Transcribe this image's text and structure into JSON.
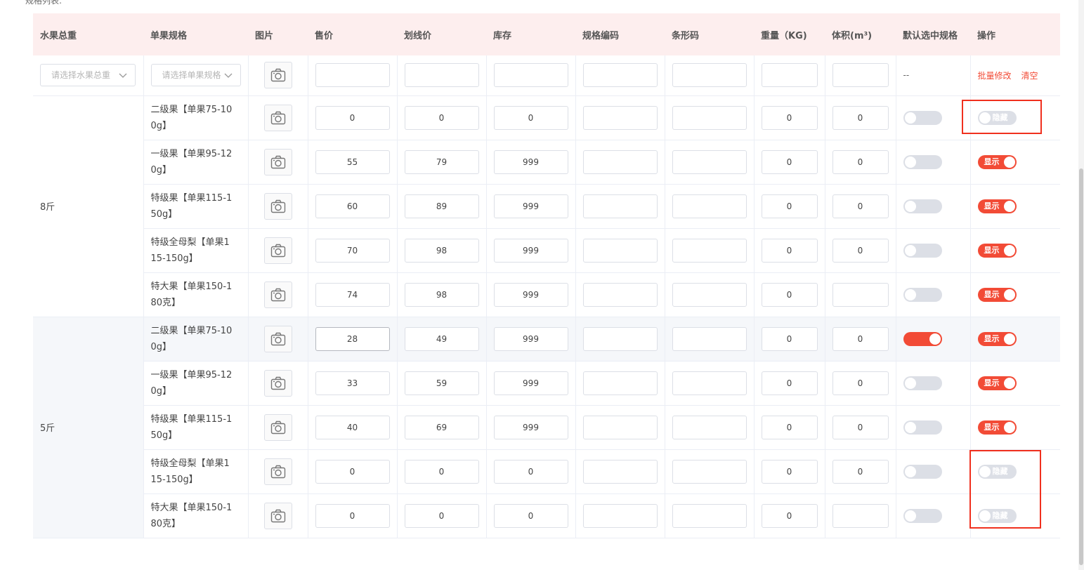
{
  "section_label": "规格列表:",
  "headers": [
    "水果总重",
    "单果规格",
    "图片",
    "售价",
    "划线价",
    "库存",
    "规格编码",
    "条形码",
    "重量（KG)",
    "体积(m³)",
    "默认选中规格",
    "操作"
  ],
  "filter_row": {
    "weight_placeholder": "请选择水果总重",
    "spec_placeholder": "请选择单果规格",
    "default_text": "--",
    "batch_edit": "批量修改",
    "clear": "清空"
  },
  "toggle_labels": {
    "shown": "显示",
    "hidden": "隐藏"
  },
  "groups": [
    {
      "weight": "8斤",
      "rows": [
        {
          "spec": "二级果【单果75-100g】",
          "price": "0",
          "strike": "0",
          "stock": "0",
          "weight": "0",
          "volume": "0",
          "default_on": false,
          "visible": false
        },
        {
          "spec": "一级果【单果95-120g】",
          "price": "55",
          "strike": "79",
          "stock": "999",
          "weight": "0",
          "volume": "0",
          "default_on": false,
          "visible": true
        },
        {
          "spec": "特级果【单果115-150g】",
          "price": "60",
          "strike": "89",
          "stock": "999",
          "weight": "0",
          "volume": "0",
          "default_on": false,
          "visible": true
        },
        {
          "spec": "特级全母梨【单果115-150g】",
          "price": "70",
          "strike": "98",
          "stock": "999",
          "weight": "0",
          "volume": "0",
          "default_on": false,
          "visible": true
        },
        {
          "spec": "特大果【单果150-180克】",
          "price": "74",
          "strike": "98",
          "stock": "999",
          "weight": "0",
          "volume": "",
          "default_on": false,
          "visible": true
        }
      ]
    },
    {
      "weight": "5斤",
      "rows": [
        {
          "spec": "二级果【单果75-100g】",
          "price": "28",
          "strike": "49",
          "stock": "999",
          "weight": "0",
          "volume": "0",
          "default_on": true,
          "visible": true,
          "highlight": true
        },
        {
          "spec": "一级果【单果95-120g】",
          "price": "33",
          "strike": "59",
          "stock": "999",
          "weight": "0",
          "volume": "0",
          "default_on": false,
          "visible": true
        },
        {
          "spec": "特级果【单果115-150g】",
          "price": "40",
          "strike": "69",
          "stock": "999",
          "weight": "0",
          "volume": "0",
          "default_on": false,
          "visible": true
        },
        {
          "spec": "特级全母梨【单果115-150g】",
          "price": "0",
          "strike": "0",
          "stock": "0",
          "weight": "0",
          "volume": "0",
          "default_on": false,
          "visible": false
        },
        {
          "spec": "特大果【单果150-180克】",
          "price": "0",
          "strike": "0",
          "stock": "0",
          "weight": "0",
          "volume": "",
          "default_on": false,
          "visible": false
        }
      ]
    }
  ],
  "colors": {
    "accent": "#f24b36",
    "header_bg": "#fdeeee",
    "annotation": "#f0301e"
  }
}
